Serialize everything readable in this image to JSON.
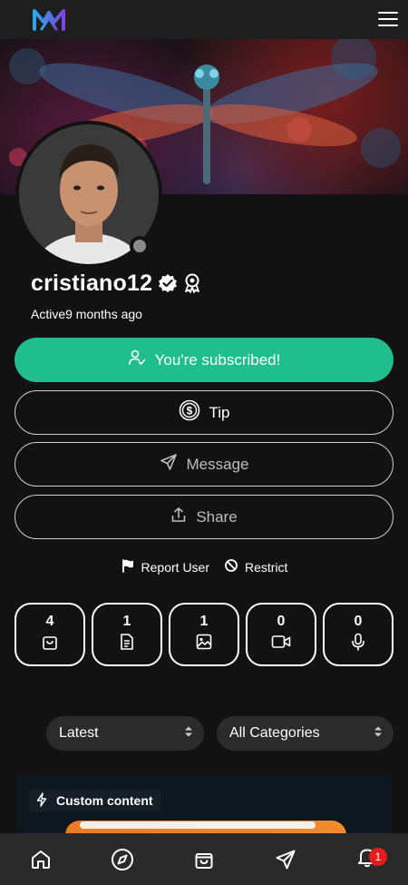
{
  "header": {
    "logo_icon": "brand-logo-icon",
    "menu_icon": "hamburger-menu-icon",
    "brand_colors": [
      "#2aa7e6",
      "#7b46e0"
    ]
  },
  "profile": {
    "username": "cristiano12",
    "verified_icon": "verified-badge-icon",
    "award_icon": "award-ribbon-icon",
    "active_label": "Active",
    "active_time": "9 months ago",
    "status_color": "#8a8a8a"
  },
  "actions": {
    "subscribed_label": "You're subscribed!",
    "tip_label": "Tip",
    "message_label": "Message",
    "share_label": "Share",
    "report_label": "Report User",
    "restrict_label": "Restrict"
  },
  "stats": [
    {
      "count": "4",
      "icon": "shopping-bag-icon"
    },
    {
      "count": "1",
      "icon": "document-icon"
    },
    {
      "count": "1",
      "icon": "image-icon"
    },
    {
      "count": "0",
      "icon": "video-icon"
    },
    {
      "count": "0",
      "icon": "microphone-icon"
    }
  ],
  "filters": {
    "sort_value": "Latest",
    "category_value": "All Categories"
  },
  "content_card": {
    "tag_label": "Custom content",
    "tag_icon": "lightning-icon"
  },
  "bottom_nav": {
    "items": [
      "home-icon",
      "compass-icon",
      "shopping-bag-icon",
      "send-icon",
      "bell-icon"
    ],
    "notification_count": "1"
  },
  "colors": {
    "accent": "#1fbe8c",
    "background": "#121212",
    "badge_red": "#e21b1b"
  }
}
